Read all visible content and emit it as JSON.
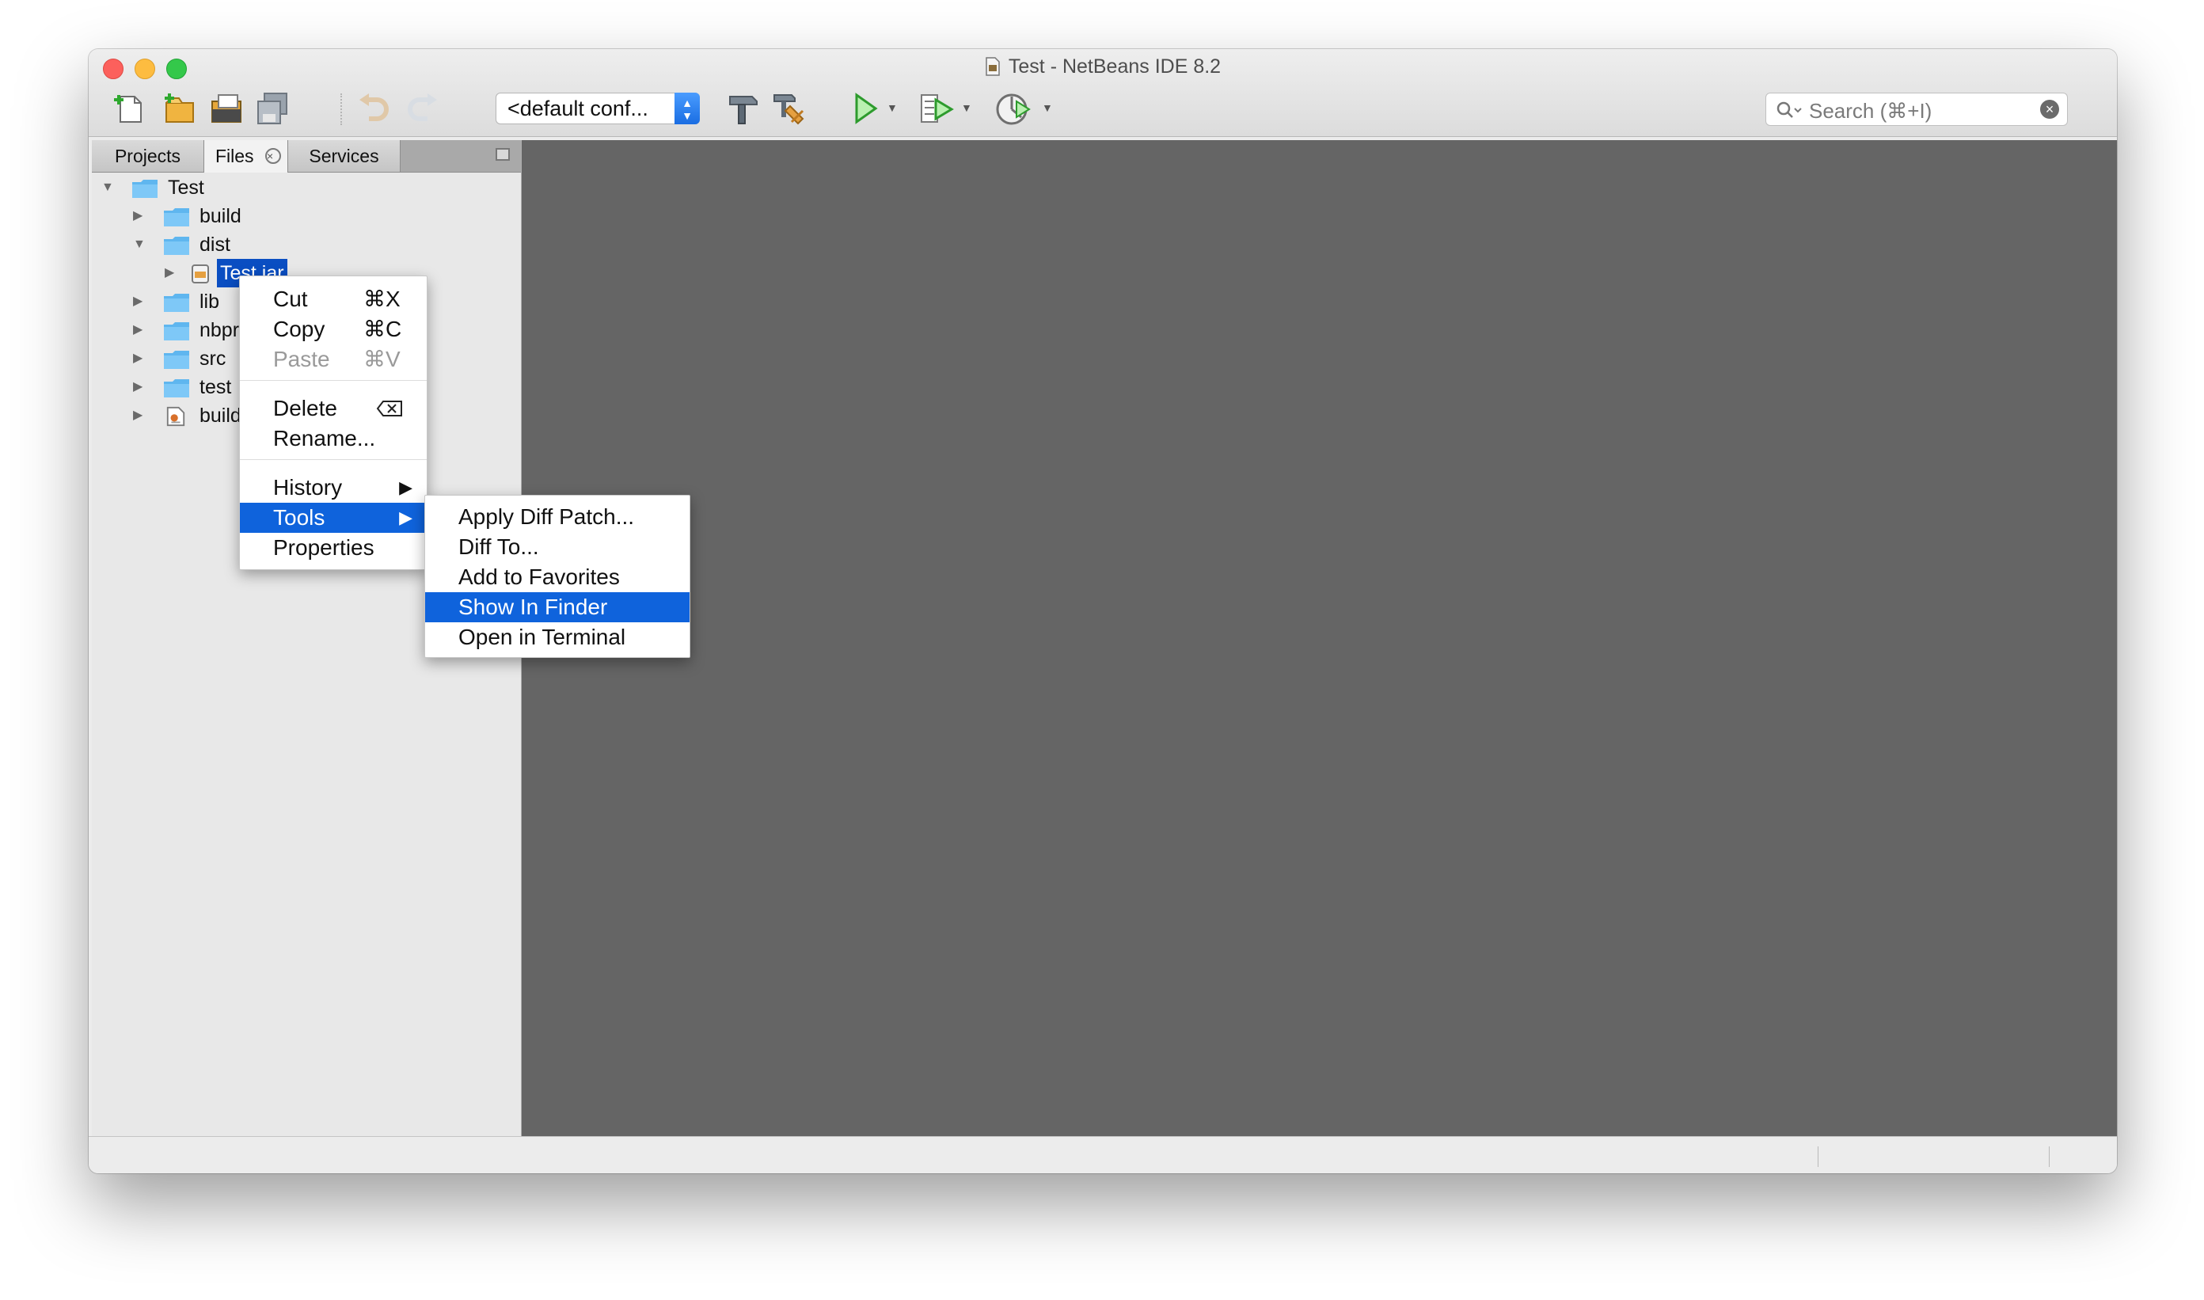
{
  "window": {
    "title": "Test - NetBeans IDE 8.2"
  },
  "toolbar": {
    "config_value": "<default conf...",
    "search_placeholder": "Search (⌘+I)"
  },
  "tabs": [
    {
      "label": "Projects"
    },
    {
      "label": "Files"
    },
    {
      "label": "Services"
    }
  ],
  "tree": {
    "root": "Test",
    "items": [
      {
        "label": "build"
      },
      {
        "label": "dist"
      },
      {
        "label": "Test.jar"
      },
      {
        "label": "lib"
      },
      {
        "label": "nbproject"
      },
      {
        "label": "src"
      },
      {
        "label": "test"
      },
      {
        "label": "build.xml"
      }
    ]
  },
  "context_menu": {
    "items": [
      {
        "label": "Cut",
        "shortcut": "⌘X"
      },
      {
        "label": "Copy",
        "shortcut": "⌘C"
      },
      {
        "label": "Paste",
        "shortcut": "⌘V"
      },
      {
        "label": "Delete"
      },
      {
        "label": "Rename..."
      },
      {
        "label": "History"
      },
      {
        "label": "Tools"
      },
      {
        "label": "Properties"
      }
    ]
  },
  "tools_submenu": {
    "items": [
      {
        "label": "Apply Diff Patch..."
      },
      {
        "label": "Diff To..."
      },
      {
        "label": "Add to Favorites"
      },
      {
        "label": "Show In Finder"
      },
      {
        "label": "Open in Terminal"
      }
    ]
  }
}
